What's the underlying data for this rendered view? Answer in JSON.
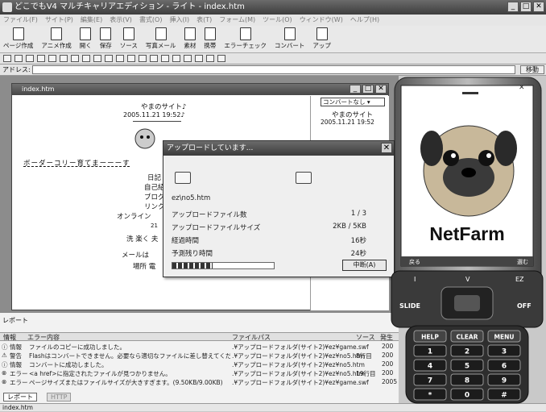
{
  "window": {
    "title": "どこでもV4 マルチキャリアエディション - ライト - index.htm"
  },
  "menu": [
    "ファイル(F)",
    "サイト(P)",
    "編集(E)",
    "表示(V)",
    "書式(O)",
    "挿入(I)",
    "表(T)",
    "フォーム(M)",
    "ツール(O)",
    "ウィンドウ(W)",
    "ヘルプ(H)"
  ],
  "toolbar": [
    "ページ作成",
    "アニメ作成",
    "開く",
    "保存",
    "ソース",
    "写真メール",
    "素材",
    "携帯",
    "エラーチェック",
    "コンバート",
    "アップ"
  ],
  "address_label": "アドレス:",
  "go_label": "移動",
  "document": {
    "title": "index.htm",
    "site_title": "やまのサイト♪",
    "date": "2005.11.21 19:52♪",
    "marquee": "ボーダーコリー育てまーーーす",
    "menu_items": [
      "日記",
      "自己紹",
      "ブログ",
      "リンク",
      "オンライン"
    ],
    "count": "21",
    "text1": "洗 楽く 夫",
    "text2": "メールは",
    "text3": "場所 電"
  },
  "preview": {
    "converter": "コンバートなし",
    "site_title": "やまのサイト",
    "date": "2005.11.21 19:52"
  },
  "dialog": {
    "title": "アップロードしています...",
    "file": "ez\\no5.htm",
    "rows": [
      {
        "label": "アップロードファイル数",
        "value": "1 / 3"
      },
      {
        "label": "アップロードファイルサイズ",
        "value": "2KB / 5KB"
      },
      {
        "label": "経過時間",
        "value": "16秒"
      },
      {
        "label": "予測残り時間",
        "value": "24秒"
      }
    ],
    "progress": 0.4,
    "cancel": "中断(A)"
  },
  "report": {
    "title": "レポート",
    "columns": [
      "情報",
      "エラー内容",
      "ファイルパス",
      "ソース",
      "発生"
    ],
    "rows": [
      {
        "type": "情報",
        "msg": "ファイルのコピーに成功しました。",
        "path": ".¥アップロードフォルダ(サイト2)¥ez¥game.swf",
        "src": "",
        "date": "200"
      },
      {
        "type": "警告",
        "msg": "Flashはコンバートできません。必要なら適切なファイルに差し替えてください。",
        "path": ".¥アップロードフォルダ(サイト2)¥ez¥no5.htm",
        "src": "8行目",
        "date": "200"
      },
      {
        "type": "情報",
        "msg": "コンバートに成功しました。",
        "path": ".¥アップロードフォルダ(サイト2)¥ez¥no5.htm",
        "src": "",
        "date": "200"
      },
      {
        "type": "エラー",
        "msg": "<a href>に指定されたファイルが見つかりません。",
        "path": ".¥アップロードフォルダ(サイト2)¥ez¥no5.htm",
        "src": "19行目",
        "date": "200"
      },
      {
        "type": "エラー",
        "msg": "ページサイズまたはファイルサイズが大きすぎます。(9.50KB/9.00KB)",
        "path": ".¥アップロードフォルダ(サイト2)¥ez¥game.swf",
        "src": "",
        "date": "2005"
      }
    ],
    "tabs": [
      "レポート",
      "HTTP"
    ]
  },
  "status": "index.htm",
  "phone": {
    "brand": "NetFarm",
    "soft_left": "戻る",
    "soft_right": "選む",
    "keys_top": [
      "I",
      "V",
      "EZ"
    ],
    "slide": "SLIDE",
    "off": "OFF",
    "func": [
      "HELP",
      "CLEAR",
      "MENU"
    ],
    "digits": [
      "1",
      "2",
      "3",
      "4",
      "5",
      "6",
      "7",
      "8",
      "9",
      "*",
      "0",
      "#"
    ]
  }
}
